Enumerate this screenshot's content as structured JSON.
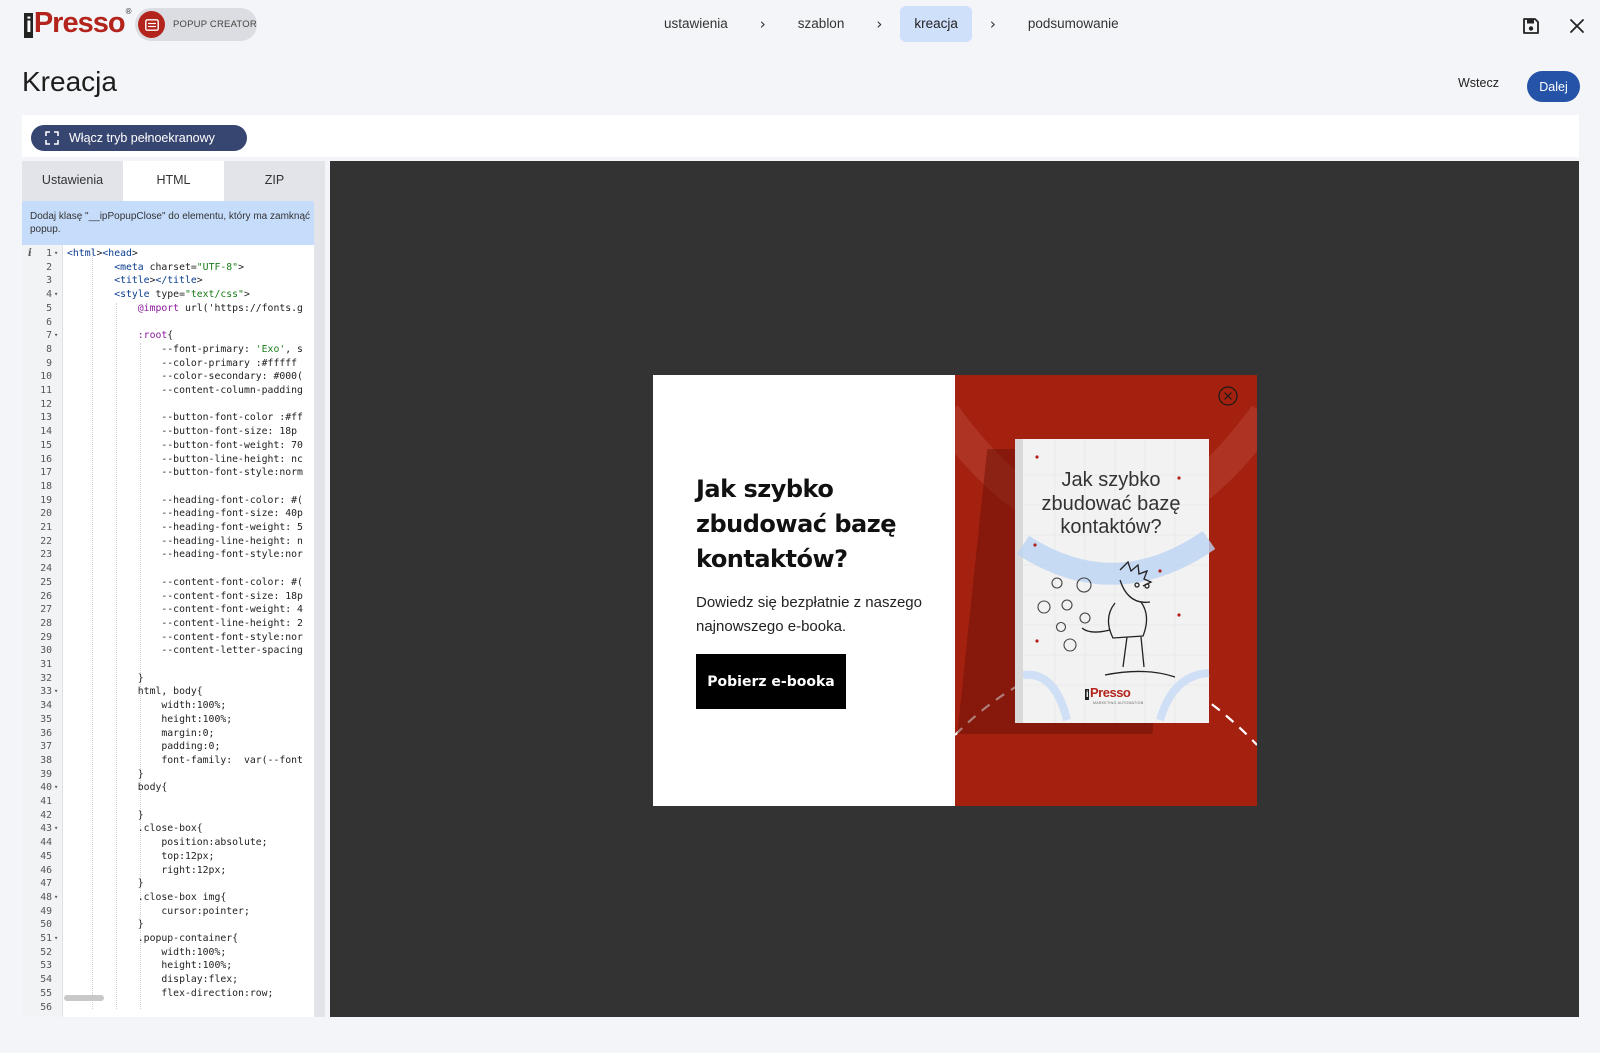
{
  "app": {
    "logo_text": "iPresso",
    "badge_label": "POPUP CREATOR"
  },
  "steps": [
    {
      "label": "ustawienia",
      "active": false
    },
    {
      "label": "szablon",
      "active": false
    },
    {
      "label": "kreacja",
      "active": true
    },
    {
      "label": "podsumowanie",
      "active": false
    }
  ],
  "header_icons": [
    "save-icon",
    "close-icon"
  ],
  "page": {
    "title": "Kreacja",
    "back_label": "Wstecz",
    "next_label": "Dalej"
  },
  "toolbar": {
    "fullscreen_label": "Włącz tryb pełnoekranowy"
  },
  "editor": {
    "tabs": [
      {
        "label": "Ustawienia",
        "active": false
      },
      {
        "label": "HTML",
        "active": true
      },
      {
        "label": "ZIP",
        "active": false
      }
    ],
    "hint": "Dodaj klasę \"__ipPopupClose\" do elementu, który ma zamknąć popup.",
    "lines": [
      "<html><head>",
      "        <meta charset=\"UTF-8\">",
      "        <title></title>",
      "        <style type=\"text/css\">",
      "            @import url('https://fonts.g",
      "",
      "            :root{",
      "                --font-primary: 'Exo', s",
      "                --color-primary :#fffff",
      "                --color-secondary: #000(",
      "                --content-column-padding",
      "",
      "                --button-font-color :#ff",
      "                --button-font-size: 18p",
      "                --button-font-weight: 70",
      "                --button-line-height: nc",
      "                --button-font-style:norm",
      "",
      "                --heading-font-color: #(",
      "                --heading-font-size: 40p",
      "                --heading-font-weight: 5",
      "                --heading-line-height: n",
      "                --heading-font-style:nor",
      "",
      "                --content-font-color: #(",
      "                --content-font-size: 18p",
      "                --content-font-weight: 4",
      "                --content-line-height: 2",
      "                --content-font-style:nor",
      "                --content-letter-spacing",
      "",
      "            }",
      "            html, body{",
      "                width:100%;",
      "                height:100%;",
      "                margin:0;",
      "                padding:0;",
      "                font-family:  var(--font",
      "            }",
      "            body{",
      "",
      "            }",
      "            .close-box{",
      "                position:absolute;",
      "                top:12px;",
      "                right:12px;",
      "            }",
      "            .close-box img{",
      "                cursor:pointer;",
      "            }",
      "            .popup-container{",
      "                width:100%;",
      "                height:100%;",
      "                display:flex;",
      "                flex-direction:row;",
      ""
    ],
    "fold_lines": [
      1,
      4,
      7,
      33,
      40,
      43,
      48,
      51
    ]
  },
  "popup": {
    "heading": "Jak szybko zbudować bazę kontaktów?",
    "text": "Dowiedz się bezpłatnie z naszego najnowszego e-booka.",
    "cta_label": "Pobierz e-booka",
    "book_title": "Jak szybko zbudować bazę kontaktów?",
    "book_logo": "iPresso",
    "book_logo_sub": "MARKETING AUTOMATION",
    "colors": {
      "accent_red": "#a4200f",
      "cta_bg": "#000000",
      "next_button": "#2453a8"
    }
  }
}
